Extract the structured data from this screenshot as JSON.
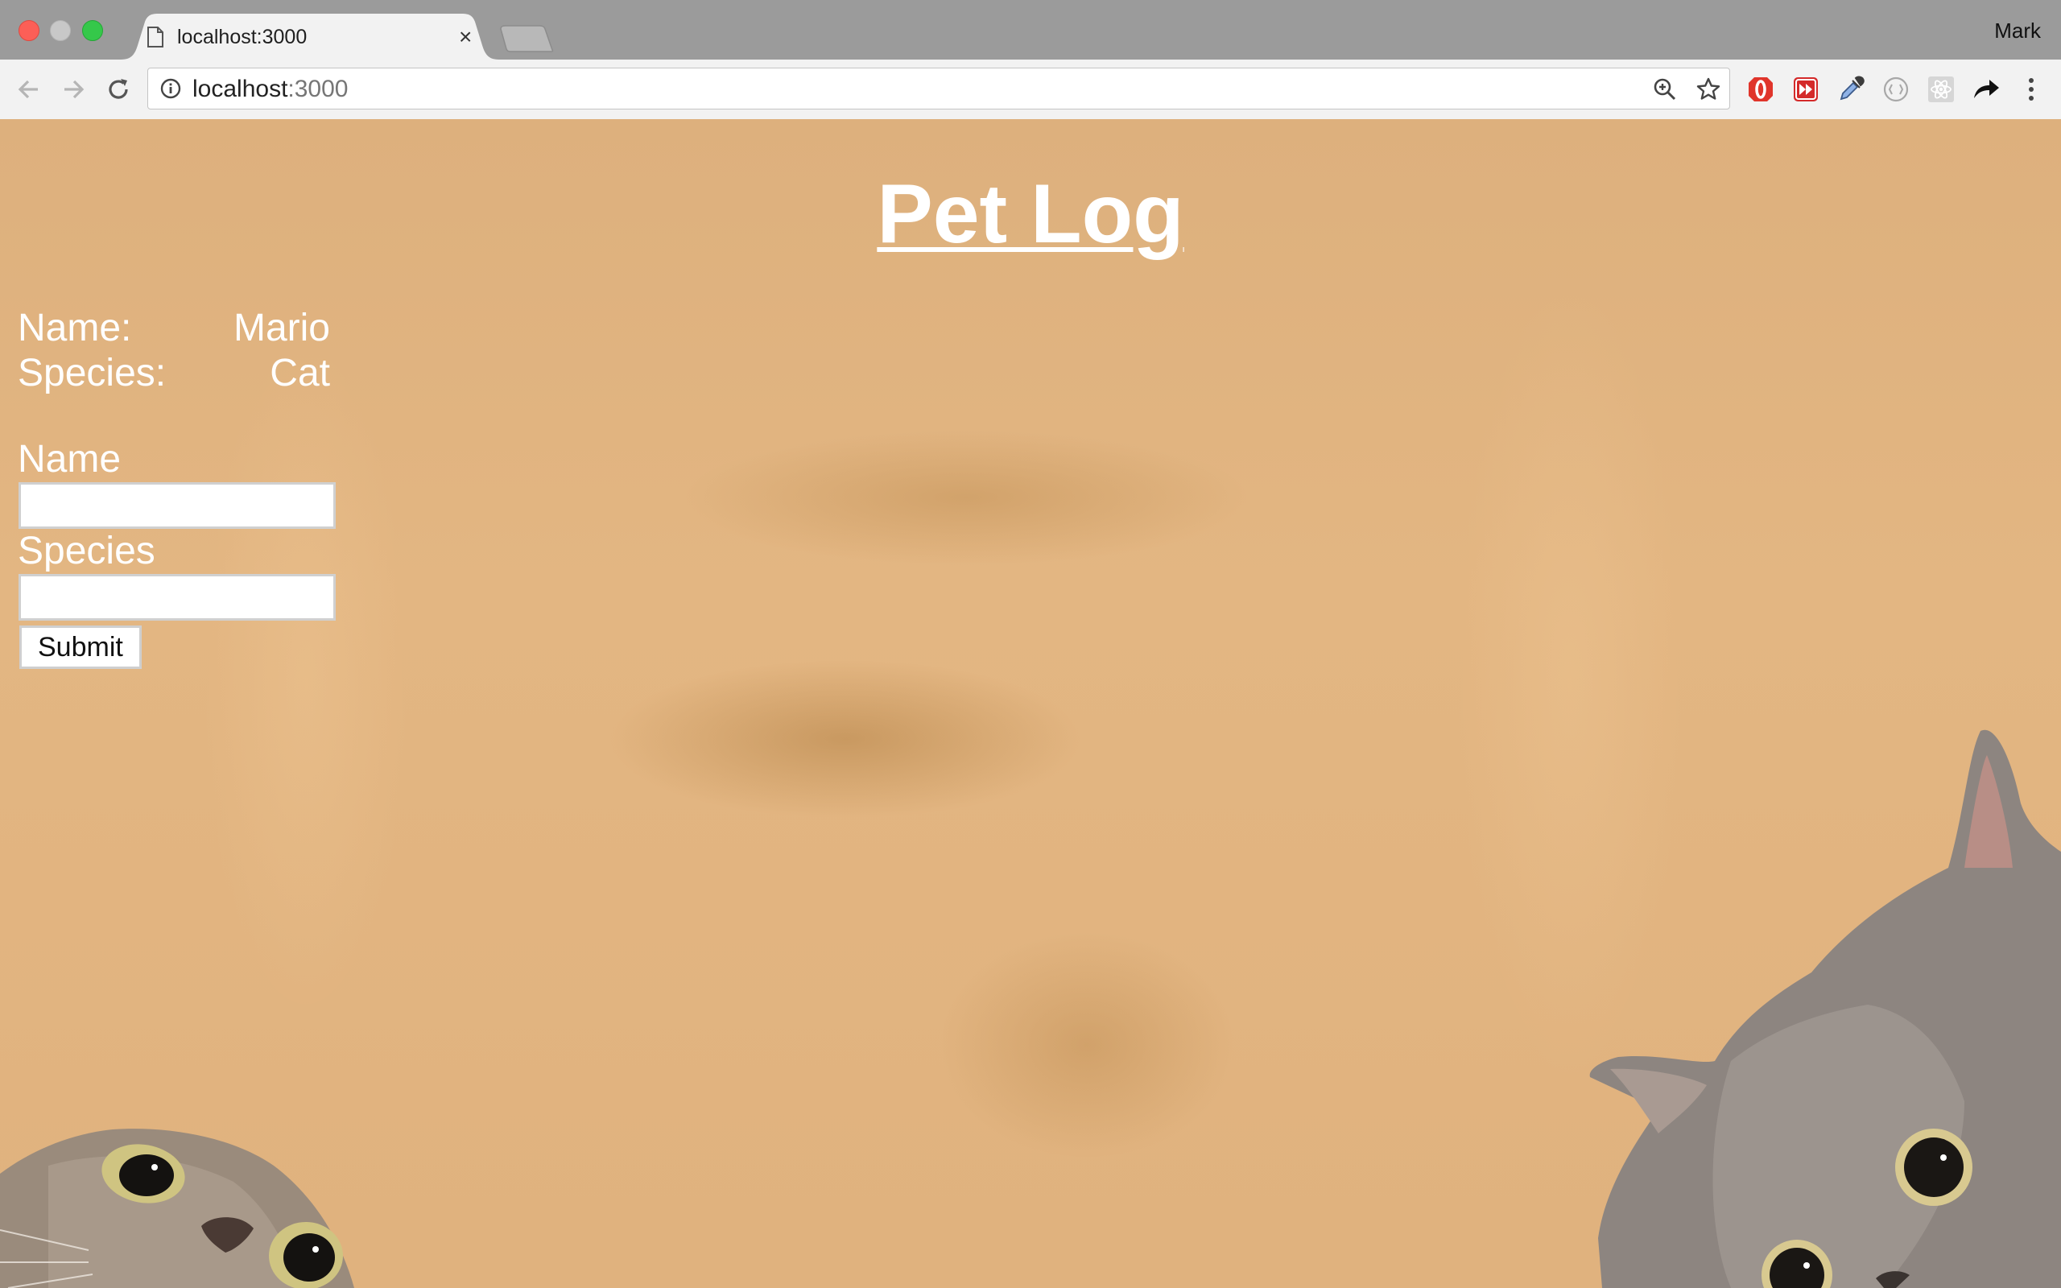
{
  "browser": {
    "tab_title": "localhost:3000",
    "tab_close_glyph": "×",
    "profile_name": "Mark",
    "url_host": "localhost",
    "url_port": ":3000"
  },
  "page": {
    "title": "Pet Log",
    "pet": {
      "name_label": "Name:",
      "name_value": "Mario",
      "species_label": "Species:",
      "species_value": "Cat"
    },
    "form": {
      "name_label": "Name",
      "name_value": "",
      "species_label": "Species",
      "species_value": "",
      "submit_label": "Submit"
    }
  },
  "icons": [
    "back-arrow-icon",
    "forward-arrow-icon",
    "reload-icon",
    "info-icon",
    "zoom-icon",
    "bookmark-star-icon",
    "opera-icon",
    "media-forward-icon",
    "eyedropper-icon",
    "extension-icon",
    "react-devtools-icon",
    "share-arrow-icon",
    "kebab-menu-icon"
  ],
  "colors": {
    "page_background": "#e2b47f",
    "title_text": "#ffffff",
    "tabstrip": "#9b9b9b",
    "toolbar": "#f2f2f2"
  }
}
